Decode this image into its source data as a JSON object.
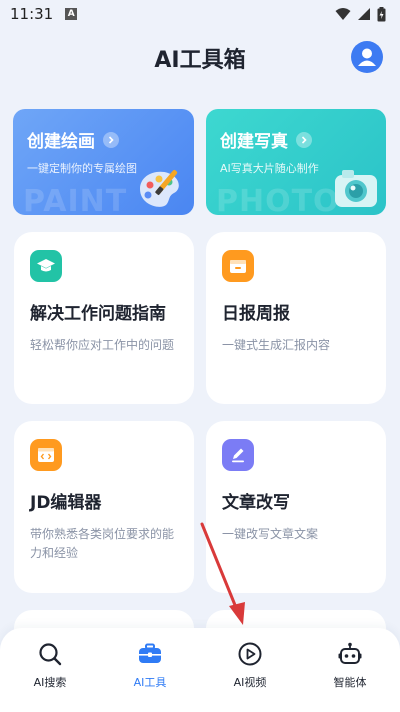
{
  "status_bar": {
    "time": "11:31",
    "notification_letter": "A"
  },
  "header": {
    "title": "AI工具箱"
  },
  "banners": [
    {
      "title": "创建绘画",
      "subtitle": "一键定制你的专属绘图",
      "watermark": "PAINT",
      "color": "#4A86F2"
    },
    {
      "title": "创建写真",
      "subtitle": "AI写真大片随心制作",
      "watermark": "PHOTO",
      "color": "#2BC3C8"
    }
  ],
  "cards": [
    {
      "title": "解决工作问题指南",
      "desc": "轻松帮你应对工作中的问题",
      "icon": "graduation-cap-icon",
      "icon_color": "#22C3A6"
    },
    {
      "title": "日报周报",
      "desc": "一键式生成汇报内容",
      "icon": "calendar-icon",
      "icon_color": "#FF9A1F"
    },
    {
      "title": "JD编辑器",
      "desc": "带你熟悉各类岗位要求的能力和经验",
      "icon": "code-browser-icon",
      "icon_color": "#FF9A1F"
    },
    {
      "title": "文章改写",
      "desc": "一键改写文章文案",
      "icon": "pen-edit-icon",
      "icon_color": "#7B7CF5"
    }
  ],
  "tab_bar": {
    "active_color": "#2F7BF5",
    "tabs": [
      {
        "label": "AI搜索",
        "icon": "search-icon",
        "active": false
      },
      {
        "label": "AI工具",
        "icon": "toolbox-icon",
        "active": true
      },
      {
        "label": "AI视频",
        "icon": "play-circle-icon",
        "active": false
      },
      {
        "label": "智能体",
        "icon": "robot-icon",
        "active": false
      }
    ]
  },
  "annotation": {
    "color": "#D93A3A"
  }
}
